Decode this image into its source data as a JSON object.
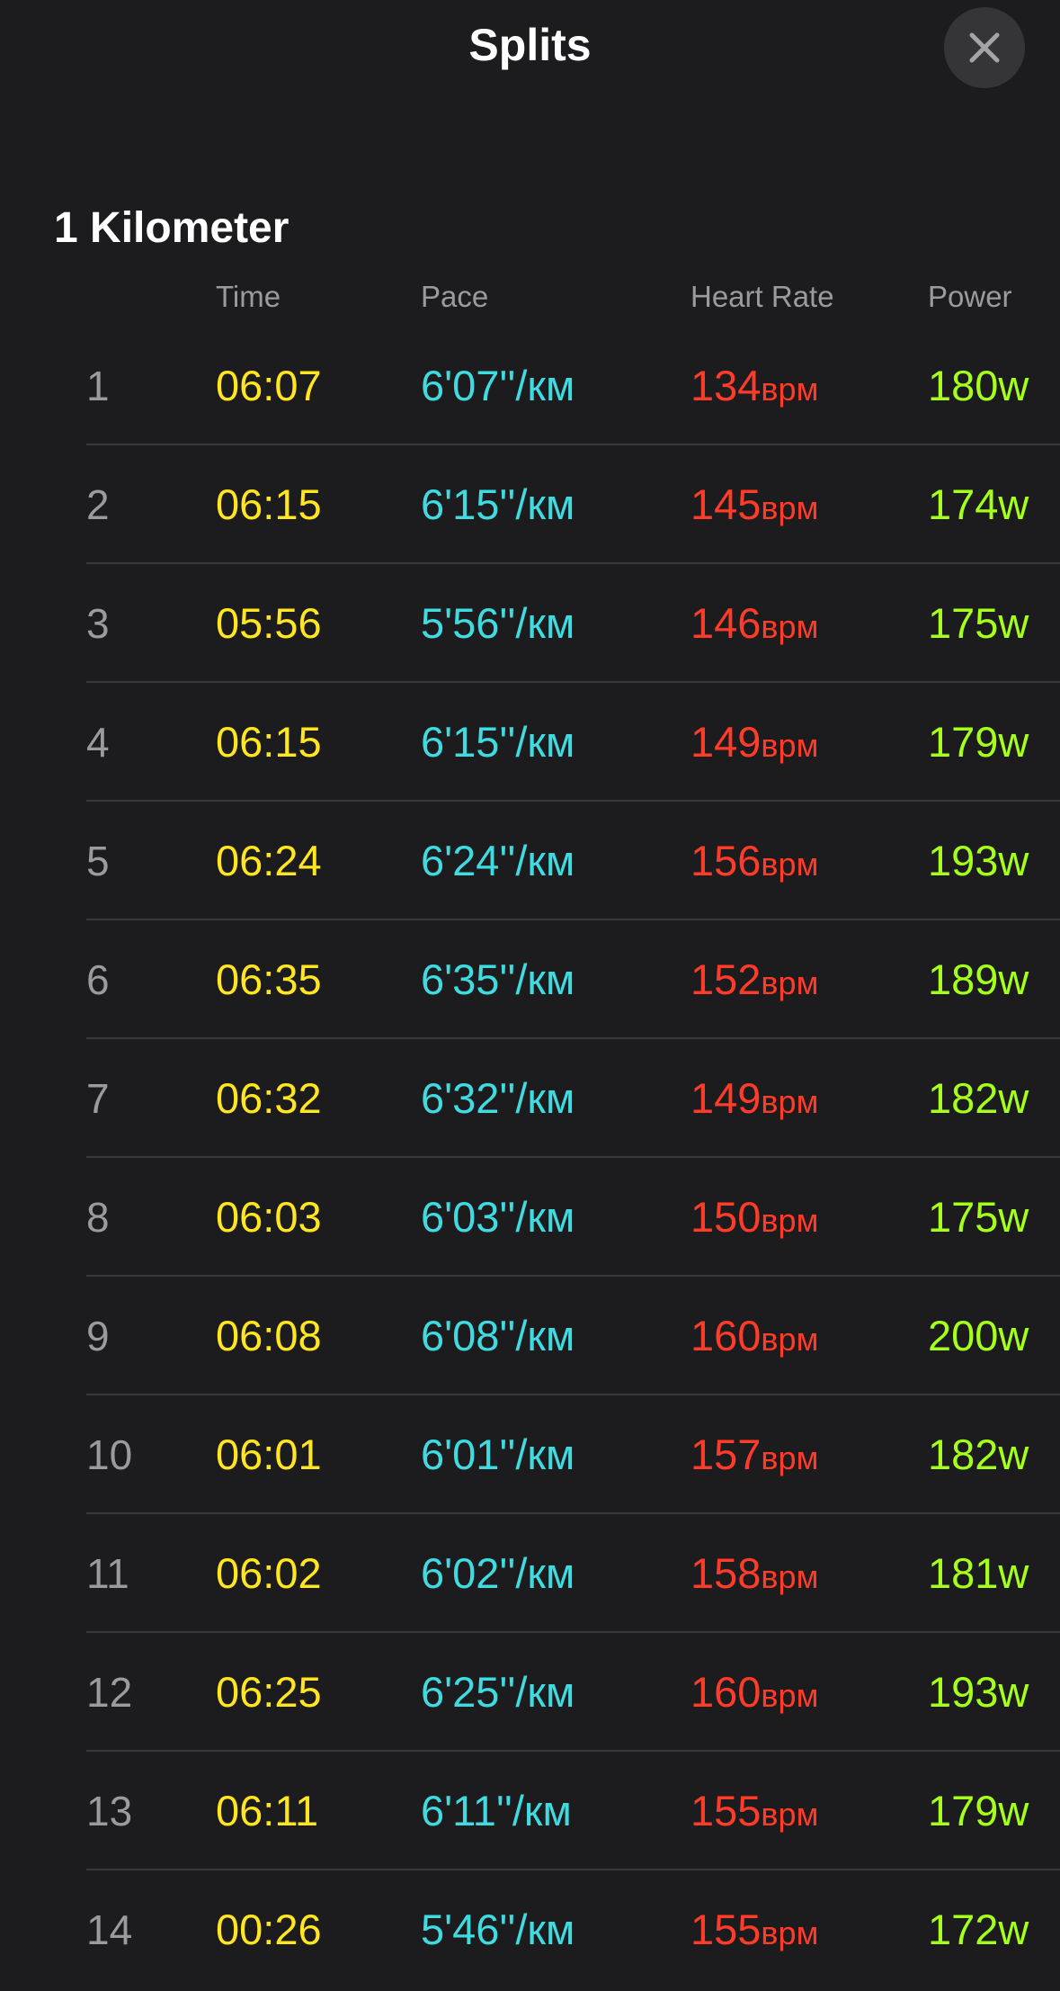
{
  "header": {
    "title": "Splits",
    "close_icon": "close-icon"
  },
  "section": {
    "title": "1 Kilometer"
  },
  "columns": {
    "time": "Time",
    "pace": "Pace",
    "heart_rate": "Heart Rate",
    "power": "Power"
  },
  "colors": {
    "background": "#1c1c1e",
    "time": "#ffe620",
    "pace": "#3fdbe0",
    "heart_rate": "#ff3b2a",
    "power": "#a6ff1a",
    "index": "#9a9a9f"
  },
  "units": {
    "pace": "''/км",
    "heart_rate": "врм",
    "power": "w"
  },
  "splits": [
    {
      "index": "1",
      "time": "06:07",
      "pace": "6'07",
      "hr": "134",
      "power": "180"
    },
    {
      "index": "2",
      "time": "06:15",
      "pace": "6'15",
      "hr": "145",
      "power": "174"
    },
    {
      "index": "3",
      "time": "05:56",
      "pace": "5'56",
      "hr": "146",
      "power": "175"
    },
    {
      "index": "4",
      "time": "06:15",
      "pace": "6'15",
      "hr": "149",
      "power": "179"
    },
    {
      "index": "5",
      "time": "06:24",
      "pace": "6'24",
      "hr": "156",
      "power": "193"
    },
    {
      "index": "6",
      "time": "06:35",
      "pace": "6'35",
      "hr": "152",
      "power": "189"
    },
    {
      "index": "7",
      "time": "06:32",
      "pace": "6'32",
      "hr": "149",
      "power": "182"
    },
    {
      "index": "8",
      "time": "06:03",
      "pace": "6'03",
      "hr": "150",
      "power": "175"
    },
    {
      "index": "9",
      "time": "06:08",
      "pace": "6'08",
      "hr": "160",
      "power": "200"
    },
    {
      "index": "10",
      "time": "06:01",
      "pace": "6'01",
      "hr": "157",
      "power": "182"
    },
    {
      "index": "11",
      "time": "06:02",
      "pace": "6'02",
      "hr": "158",
      "power": "181"
    },
    {
      "index": "12",
      "time": "06:25",
      "pace": "6'25",
      "hr": "160",
      "power": "193"
    },
    {
      "index": "13",
      "time": "06:11",
      "pace": "6'11",
      "hr": "155",
      "power": "179"
    },
    {
      "index": "14",
      "time": "00:26",
      "pace": "5'46",
      "hr": "155",
      "power": "172"
    }
  ]
}
